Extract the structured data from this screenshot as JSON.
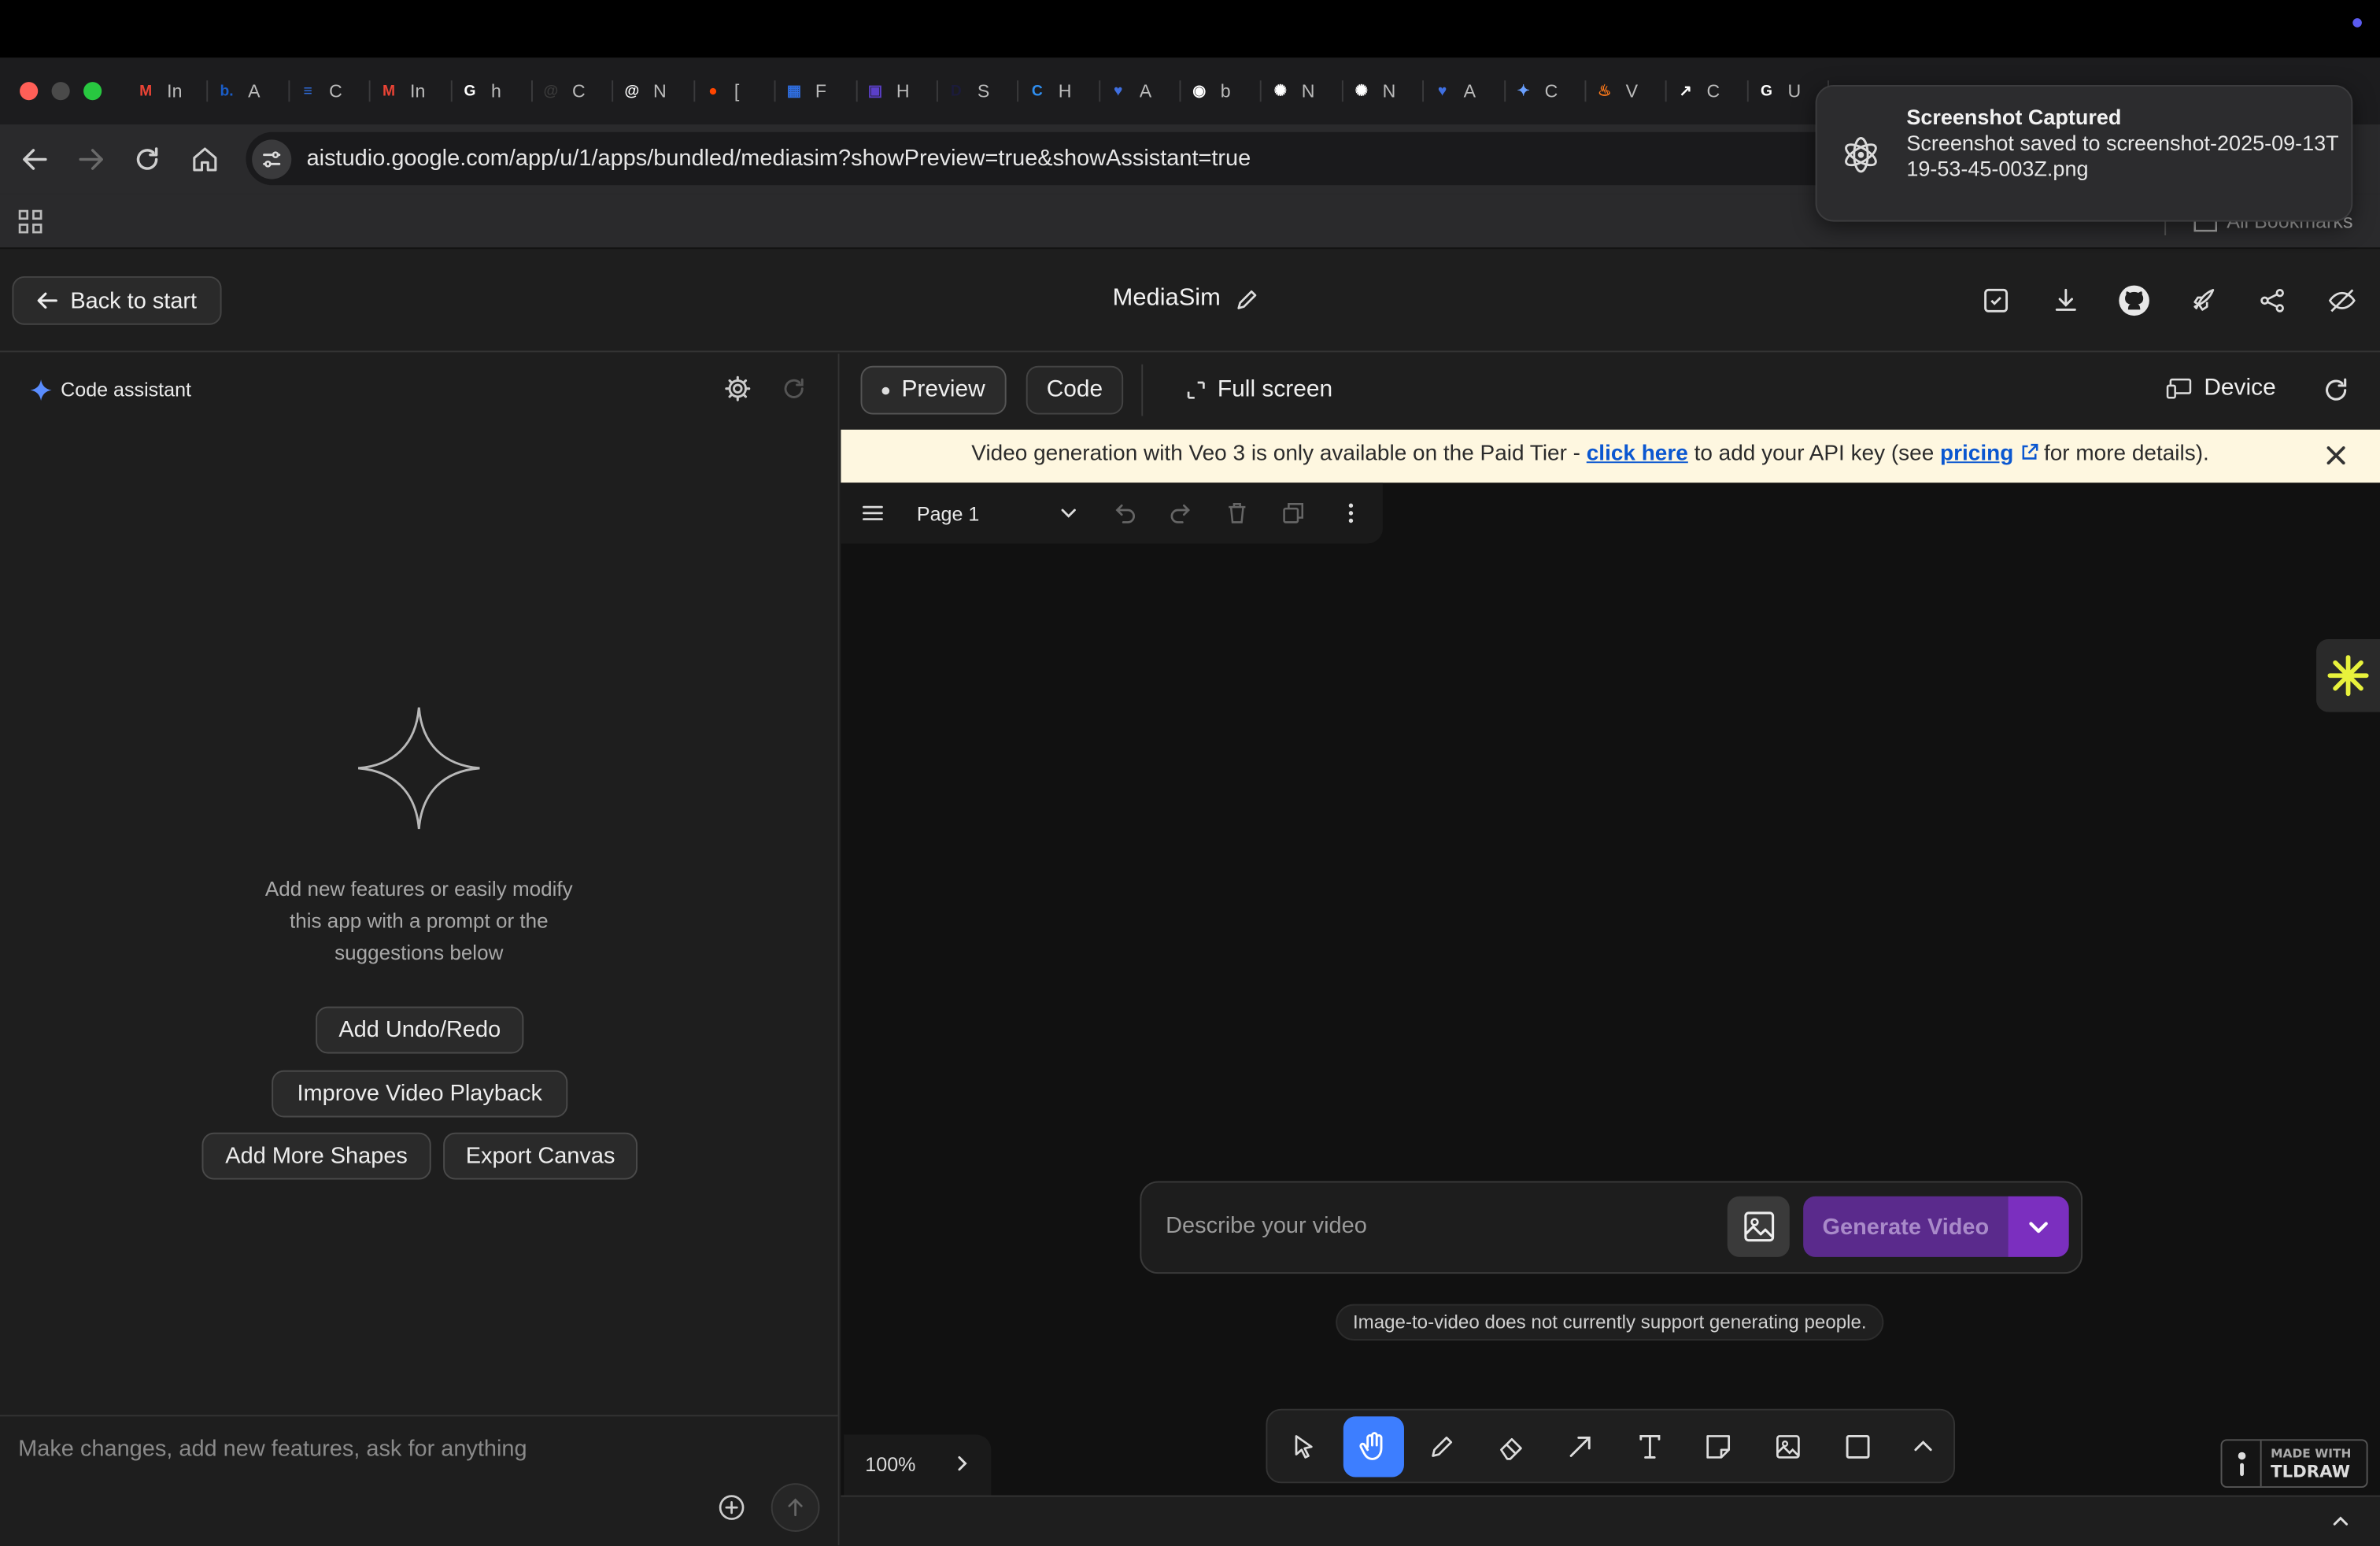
{
  "browser": {
    "tabs": [
      {
        "icon": "gmail-icon",
        "letter": "M",
        "color": "#ea4335",
        "label": "In"
      },
      {
        "icon": "booking-icon",
        "letter": "b.",
        "color": "#1a5dc8",
        "label": "A"
      },
      {
        "icon": "docs-icon",
        "letter": "≡",
        "color": "#2f6ee0",
        "label": "C"
      },
      {
        "icon": "gmail-icon",
        "letter": "M",
        "color": "#ea4335",
        "label": "In"
      },
      {
        "icon": "google-icon",
        "letter": "G",
        "color": "#ffffff",
        "label": "h"
      },
      {
        "icon": "spiral-icon",
        "letter": "@",
        "color": "#3a3a3a",
        "label": "C"
      },
      {
        "icon": "spiral-icon",
        "letter": "@",
        "color": "#ffffff",
        "label": "N"
      },
      {
        "icon": "reddit-icon",
        "letter": "●",
        "color": "#ff4500",
        "label": "["
      },
      {
        "icon": "grid-app-icon",
        "letter": "▦",
        "color": "#2f6ee0",
        "label": "F"
      },
      {
        "icon": "slack-icon",
        "letter": "▣",
        "color": "#5b3fc8",
        "label": "H"
      },
      {
        "icon": "d-icon",
        "letter": "D",
        "color": "#1b1b3a",
        "label": "S"
      },
      {
        "icon": "c-icon",
        "letter": "C",
        "color": "#2f8ef0",
        "label": "H"
      },
      {
        "icon": "heart-icon",
        "letter": "♥",
        "color": "#3f6fe0",
        "label": "A"
      },
      {
        "icon": "github-icon",
        "letter": "◉",
        "color": "#ffffff",
        "label": "b"
      },
      {
        "icon": "openai-icon",
        "letter": "✺",
        "color": "#ffffff",
        "label": "N"
      },
      {
        "icon": "openai-icon",
        "letter": "✺",
        "color": "#ffffff",
        "label": "N"
      },
      {
        "icon": "heart-icon",
        "letter": "♥",
        "color": "#3f6fe0",
        "label": "A"
      },
      {
        "icon": "gemini-icon",
        "letter": "✦",
        "color": "#6aa0ff",
        "label": "C"
      },
      {
        "icon": "fire-icon",
        "letter": "♨",
        "color": "#ff7a1a",
        "label": "V"
      },
      {
        "icon": "external-icon",
        "letter": "↗",
        "color": "#ffffff",
        "label": "C"
      },
      {
        "icon": "google-icon",
        "letter": "G",
        "color": "#ffffff",
        "label": "U"
      }
    ],
    "url": "aistudio.google.com/app/u/1/apps/bundled/mediasim?showPreview=true&showAssistant=true",
    "all_bookmarks": "All Bookmarks"
  },
  "toast": {
    "title": "Screenshot Captured",
    "body": "Screenshot saved to screenshot-2025-09-13T19-53-45-003Z.png"
  },
  "header": {
    "back_label": "Back to start",
    "app_name": "MediaSim"
  },
  "assistant": {
    "title": "Code assistant",
    "empty_text": "Add new features or easily modify this app with a prompt or the suggestions below",
    "suggestions": [
      "Add Undo/Redo",
      "Improve Video Playback",
      "Add More Shapes",
      "Export Canvas"
    ],
    "prompt_placeholder": "Make changes, add new features, ask for anything"
  },
  "preview": {
    "tabs": {
      "preview": "Preview",
      "code": "Code",
      "fullscreen": "Full screen"
    },
    "device": "Device",
    "banner": {
      "before": "Video generation with Veo 3 is only available on the Paid Tier - ",
      "link1": "click here",
      "middle": " to add your API key (see ",
      "link2": "pricing",
      "after": " for more details)."
    },
    "page_name": "Page 1",
    "video_placeholder": "Describe your video",
    "generate_label": "Generate Video",
    "notice": "Image-to-video does not currently support generating people.",
    "zoom": "100%",
    "tldraw_small": "MADE WITH",
    "tldraw_big": "TLDRAW",
    "accent": "#3d7eff",
    "generate_color": "#7b2fbf"
  }
}
